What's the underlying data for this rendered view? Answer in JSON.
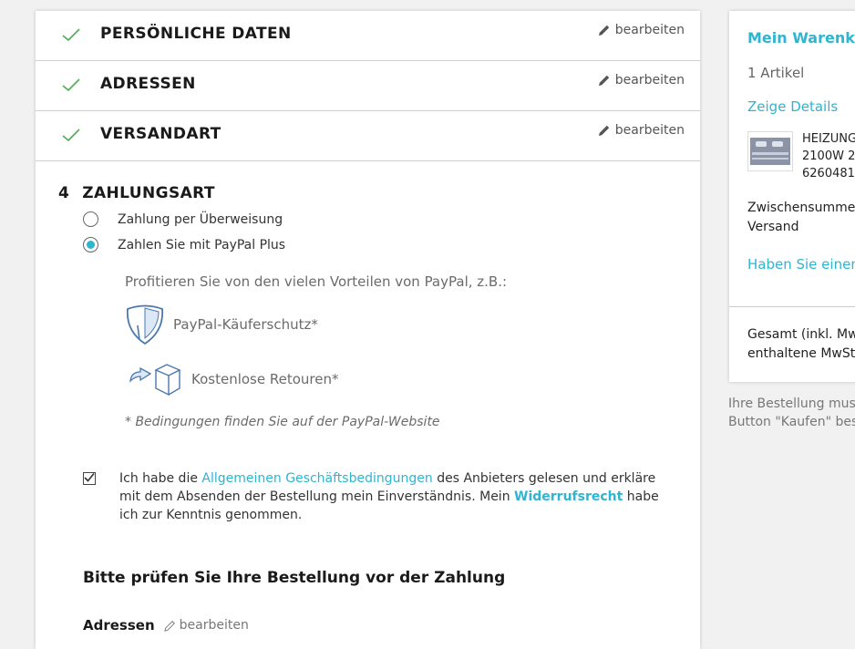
{
  "steps": [
    {
      "title": "PERSÖNLICHE DATEN",
      "edit": "bearbeiten"
    },
    {
      "title": "ADRESSEN",
      "edit": "bearbeiten"
    },
    {
      "title": "VERSANDART",
      "edit": "bearbeiten"
    }
  ],
  "payment": {
    "number": "4",
    "title": "ZAHLUNGSART",
    "options": [
      {
        "label": "Zahlung per Überweisung",
        "selected": false
      },
      {
        "label": "Zahlen Sie mit PayPal Plus",
        "selected": true
      }
    ],
    "paypal_intro": "Profitieren Sie von den vielen Vorteilen von PayPal, z.B.:",
    "features": [
      {
        "label": "PayPal-Käuferschutz*",
        "icon": "shield-icon"
      },
      {
        "label": "Kostenlose Retouren*",
        "icon": "return-box-icon"
      }
    ],
    "note": "* Bedingungen finden Sie auf der PayPal-Website"
  },
  "agb": {
    "checked": true,
    "text_1": "Ich habe die ",
    "link_agb": "Allgemeinen Geschäftsbedingungen",
    "text_2": " des Anbieters gelesen und erkläre mit dem Absenden der Bestellung mein Einverständnis. Mein ",
    "link_widerruf": "Widerrufsrecht",
    "text_3": " habe ich zur Kenntnis genommen."
  },
  "review": {
    "title": "Bitte prüfen Sie Ihre Bestellung vor der Zahlung",
    "addresses_label": "Adressen",
    "edit": "bearbeiten"
  },
  "cart": {
    "title": "Mein Warenkorb",
    "count": "1 Artikel",
    "details_link": "Zeige Details",
    "product_line_1": "HEIZUNG",
    "product_line_2": "2100W 2",
    "product_line_3": "6260481",
    "subtotal_label": "Zwischensumme",
    "shipping_label": "Versand",
    "coupon_link": "Haben Sie einen G",
    "total_label": "Gesamt (inkl. MwSt",
    "vat_label": "enthaltene MwSt."
  },
  "side_note": {
    "line_1": "Ihre Bestellung mus",
    "line_2": "Button \"Kaufen\" bes"
  },
  "colors": {
    "accent": "#2eb5d0",
    "check": "#4caf50",
    "paypal_blue": "#4a78b0"
  }
}
